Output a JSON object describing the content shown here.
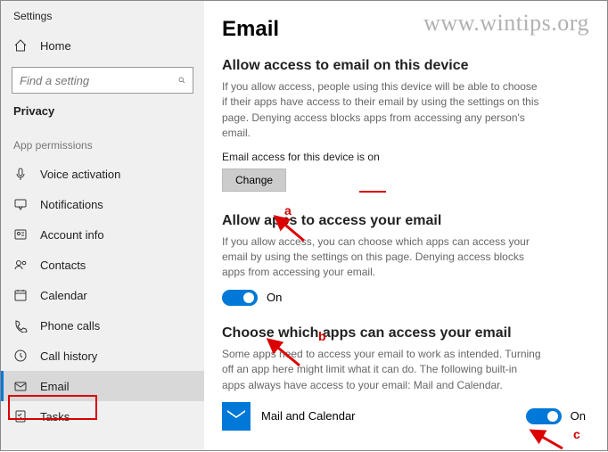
{
  "window": {
    "title": "Settings"
  },
  "sidebar": {
    "home": "Home",
    "search_placeholder": "Find a setting",
    "section": "Privacy",
    "group": "App permissions",
    "items": [
      {
        "label": "Voice activation",
        "icon": "mic-icon"
      },
      {
        "label": "Notifications",
        "icon": "notification-icon"
      },
      {
        "label": "Account info",
        "icon": "account-icon"
      },
      {
        "label": "Contacts",
        "icon": "contacts-icon"
      },
      {
        "label": "Calendar",
        "icon": "calendar-icon"
      },
      {
        "label": "Phone calls",
        "icon": "phone-icon"
      },
      {
        "label": "Call history",
        "icon": "history-icon"
      },
      {
        "label": "Email",
        "icon": "email-icon",
        "selected": true
      },
      {
        "label": "Tasks",
        "icon": "tasks-icon"
      }
    ]
  },
  "main": {
    "title": "Email",
    "section1": {
      "heading": "Allow access to email on this device",
      "desc": "If you allow access, people using this device will be able to choose if their apps have access to their email by using the settings on this page. Denying access blocks apps from accessing any person's email.",
      "status": "Email access for this device is on",
      "change_btn": "Change"
    },
    "section2": {
      "heading": "Allow apps to access your email",
      "desc": "If you allow access, you can choose which apps can access your email by using the settings on this page. Denying access blocks apps from accessing your email.",
      "toggle_label": "On"
    },
    "section3": {
      "heading": "Choose which apps can access your email",
      "desc": "Some apps need to access your email to work as intended. Turning off an app here might limit what it can do. The following built-in apps always have access to your email: Mail and Calendar.",
      "app": {
        "name": "Mail and Calendar",
        "toggle_label": "On"
      }
    }
  },
  "watermark": "www.wintips.org",
  "annotations": {
    "a": "a",
    "b": "b",
    "c": "c"
  }
}
